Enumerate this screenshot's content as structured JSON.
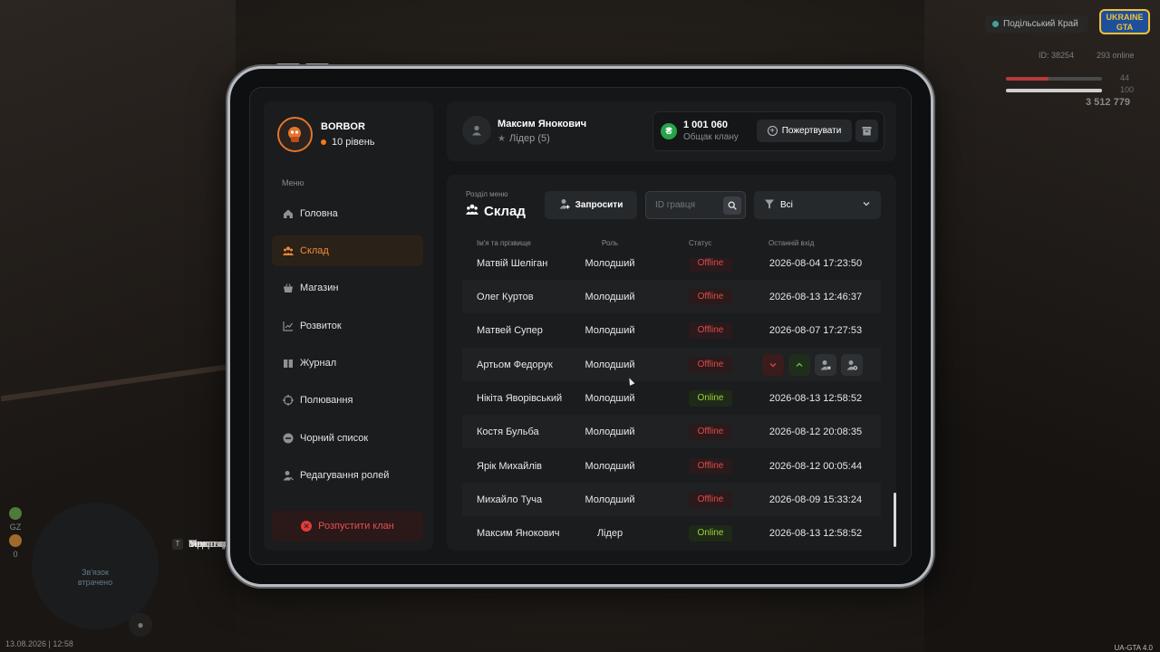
{
  "hud": {
    "region": "Подільський Край",
    "logo_line1": "UKRAINE",
    "logo_line2": "GTA",
    "id": "ID: 38254",
    "online": "293 online",
    "health": "44",
    "armor": "100",
    "money": "3 512 779",
    "indicator": "GZ",
    "indicator_count": "0",
    "zone_text": "Зв'язок втрачено",
    "keys": [
      {
        "key": "O",
        "label": "Меню гравця"
      },
      {
        "key": "P",
        "label": "Відкрити телефон"
      },
      {
        "key": "I",
        "label": "Інвентар"
      },
      {
        "key": "T",
        "label": "Текстовий чат"
      }
    ],
    "datetime": "13.08.2026 | 12:58",
    "version": "UA-GTA 4.0"
  },
  "clan": {
    "name": "BORBOR",
    "level": "10 рівень"
  },
  "menu": {
    "caption": "Меню",
    "items": [
      {
        "label": "Головна",
        "icon": "home-icon"
      },
      {
        "label": "Склад",
        "icon": "people-icon"
      },
      {
        "label": "Магазин",
        "icon": "basket-icon"
      },
      {
        "label": "Розвиток",
        "icon": "chart-icon"
      },
      {
        "label": "Журнал",
        "icon": "book-icon"
      },
      {
        "label": "Полювання",
        "icon": "crosshair-icon"
      },
      {
        "label": "Чорний список",
        "icon": "minus-circle-icon"
      },
      {
        "label": "Редагування ролей",
        "icon": "user-edit-icon"
      }
    ],
    "active_index": 1,
    "dissolve_label": "Розпустити клан"
  },
  "user": {
    "name": "Максим Янокович",
    "role": "Лідер (5)"
  },
  "wallet": {
    "amount": "1 001 060",
    "label": "Общак клану",
    "donate_label": "Пожертвувати"
  },
  "section": {
    "caption": "Розділ меню",
    "title": "Склад",
    "invite_label": "Запросити",
    "id_placeholder": "ID гравця",
    "filter_value": "Всі"
  },
  "table": {
    "headers": [
      "Ім'я та прізвище",
      "Роль",
      "Статус",
      "Останній вхід"
    ],
    "rows": [
      {
        "name": "Матвій Шеліган",
        "role": "Молодший",
        "status": "Offline",
        "last": "2026-08-04 17:23:50"
      },
      {
        "name": "Олег Куртов",
        "role": "Молодший",
        "status": "Offline",
        "last": "2026-08-13 12:46:37"
      },
      {
        "name": "Матвей Супер",
        "role": "Молодший",
        "status": "Offline",
        "last": "2026-08-07 17:27:53"
      },
      {
        "name": "Артьом Федорук",
        "role": "Молодший",
        "status": "Offline",
        "last": ""
      },
      {
        "name": "Нікіта Яворівський",
        "role": "Молодший",
        "status": "Online",
        "last": "2026-08-13 12:58:52"
      },
      {
        "name": "Костя Бульба",
        "role": "Молодший",
        "status": "Offline",
        "last": "2026-08-12 20:08:35"
      },
      {
        "name": "Ярік Михайлів",
        "role": "Молодший",
        "status": "Offline",
        "last": "2026-08-12 00:05:44"
      },
      {
        "name": "Михайло Туча",
        "role": "Молодший",
        "status": "Offline",
        "last": "2026-08-09 15:33:24"
      },
      {
        "name": "Максим Янокович",
        "role": "Лідер",
        "status": "Online",
        "last": "2026-08-13 12:58:52"
      }
    ],
    "hovered_row_index": 3
  },
  "colors": {
    "accent": "#f08a3a",
    "offline": "#e24a4a",
    "online": "#9fd23a",
    "coin": "#27a34a"
  }
}
